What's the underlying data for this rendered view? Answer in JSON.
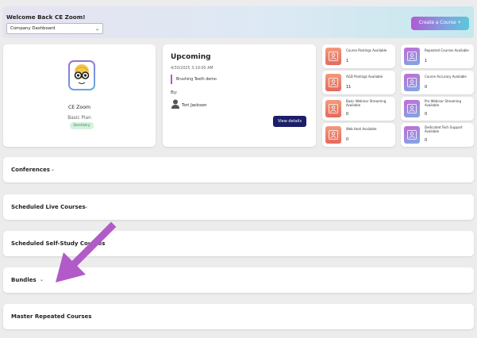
{
  "header": {
    "welcome": "Welcome Back CE Zoom!",
    "dashboard_select": "Company Dashboard",
    "create_label": "Create a Course +"
  },
  "profile": {
    "name": "CE Zoom",
    "plan": "Basic Plan",
    "tag": "Dentistry"
  },
  "upcoming": {
    "title": "Upcoming",
    "date": "4/30/2025 3:19:00 AM",
    "event": "Brushing Teeth demo",
    "by_label": "By:",
    "person": "Tori Jackson",
    "view_label": "View details"
  },
  "stats": [
    {
      "label": "Course Postings Available",
      "value": "1",
      "color": "orange"
    },
    {
      "label": "Repeated Courses Available",
      "value": "1",
      "color": "purple"
    },
    {
      "label": "AGD Postings Available",
      "value": "11",
      "color": "orange"
    },
    {
      "label": "Course Accuracy Available",
      "value": "0",
      "color": "purple"
    },
    {
      "label": "Basic Webinar Streaming Available",
      "value": "0",
      "color": "orange"
    },
    {
      "label": "Pro Webinar Streaming Available",
      "value": "0",
      "color": "purple"
    },
    {
      "label": "Web Host Available",
      "value": "0",
      "color": "orange"
    },
    {
      "label": "Dedicated Tech Support Available",
      "value": "0",
      "color": "purple"
    }
  ],
  "sections": [
    {
      "label": "Conferences"
    },
    {
      "label": "Scheduled Live Courses"
    },
    {
      "label": "Scheduled Self-Study Courses"
    },
    {
      "label": "Bundles"
    },
    {
      "label": "Master Repeated Courses"
    }
  ],
  "colors": {
    "accent_purple": "#b05ad3",
    "navy_button": "#1b1e69",
    "annotation_arrow": "#b25ac8"
  }
}
